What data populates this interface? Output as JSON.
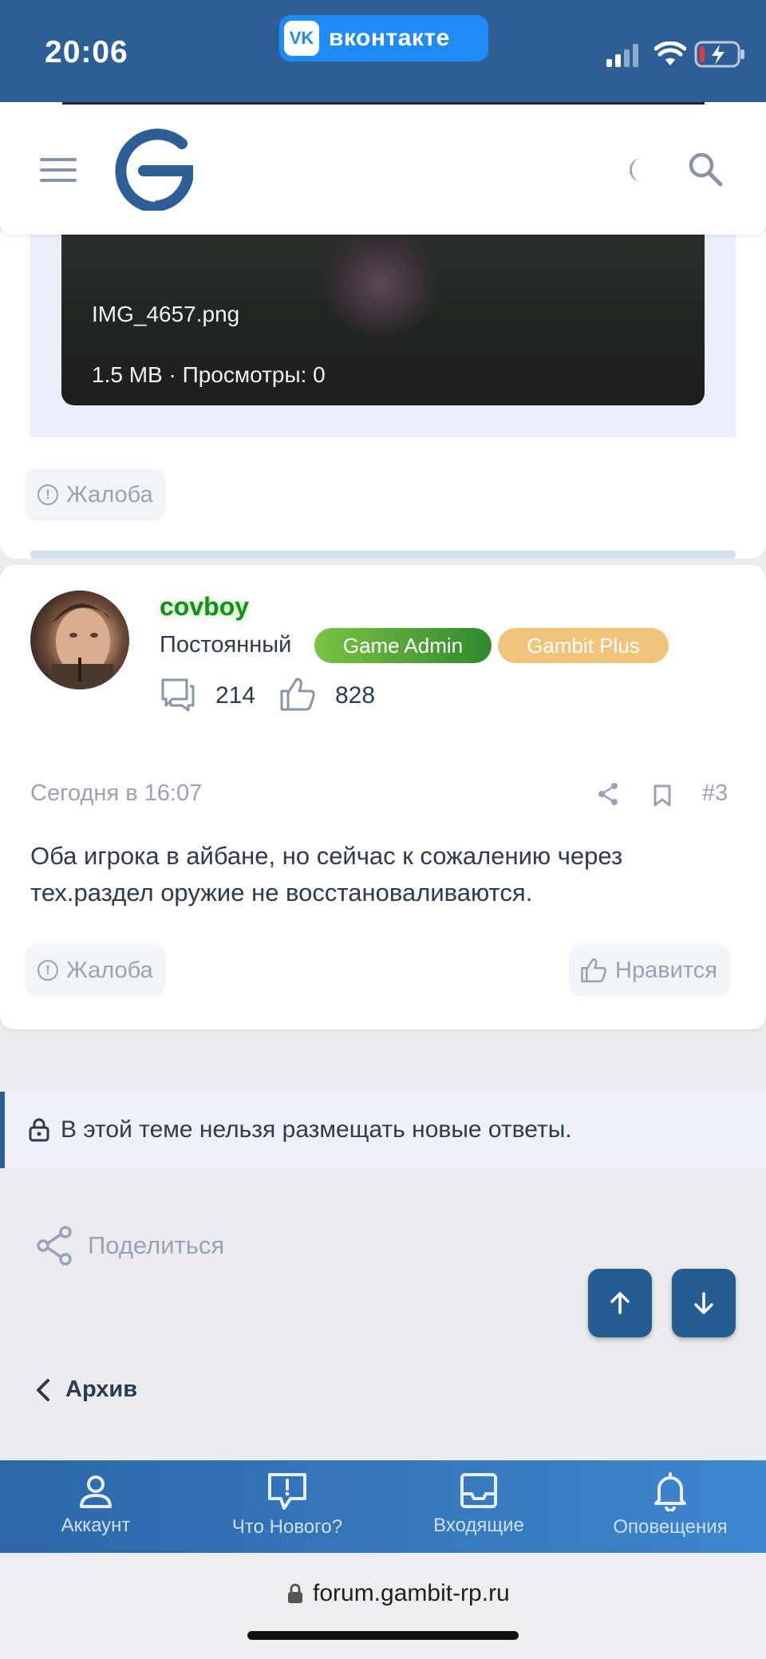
{
  "status_bar": {
    "time": "20:06",
    "vk_label": "вконтакте",
    "vk_logo": "VK"
  },
  "post1": {
    "attachment": {
      "filename": "IMG_4657.png",
      "meta": "1.5 MB · Просмотры: 0"
    },
    "report_label": "Жалоба"
  },
  "post2": {
    "username": "covboy",
    "rank": "Постоянный",
    "badges": [
      "Game Admin",
      "Gambit Plus"
    ],
    "messages_count": "214",
    "likes_count": "828",
    "date": "Сегодня в 16:07",
    "post_number": "#3",
    "body": "Оба игрока в айбане, но сейчас к сожалению через тех.раздел оружие не восстановаливаются.",
    "report_label": "Жалоба",
    "like_label": "Нравится"
  },
  "locked_notice": "В этой теме нельзя размещать новые ответы.",
  "share_label": "Поделиться",
  "breadcrumb_label": "Архив",
  "bottom_nav": [
    {
      "label": "Аккаунт",
      "icon": "user-icon"
    },
    {
      "label": "Что Нового?",
      "icon": "news-icon"
    },
    {
      "label": "Входящие",
      "icon": "inbox-icon"
    },
    {
      "label": "Оповещения",
      "icon": "bell-icon"
    }
  ],
  "browser": {
    "url": "forum.gambit-rp.ru"
  },
  "colors": {
    "brand": "#2d5f96",
    "admin_badge": "#3f9d3a",
    "plus_badge": "#f0c47a",
    "username": "#1d8a1d"
  }
}
